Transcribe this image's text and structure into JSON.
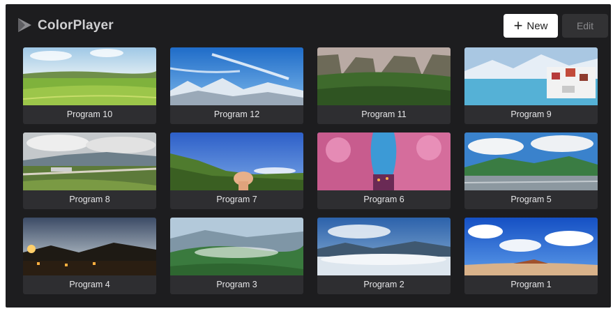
{
  "header": {
    "app_title": "ColorPlayer",
    "new_label": "New",
    "edit_label": "Edit"
  },
  "programs": [
    {
      "label": "Program 10",
      "scene": "green-field",
      "colors": {
        "sky": "#cfe3f2",
        "ground": "#7fb23c"
      }
    },
    {
      "label": "Program 12",
      "scene": "blue-sky-snow-mountains",
      "colors": {
        "sky": "#2f7fd4",
        "ground": "#e9eef5"
      }
    },
    {
      "label": "Program 11",
      "scene": "green-canyon-cliffs",
      "colors": {
        "sky": "#b7a7a2",
        "ground": "#3f6a2e"
      }
    },
    {
      "label": "Program 9",
      "scene": "snow-village-lake",
      "colors": {
        "sky": "#8fb6d9",
        "ground": "#5ab3d6"
      }
    },
    {
      "label": "Program 8",
      "scene": "cloudy-valley-town",
      "colors": {
        "sky": "#bfc3c6",
        "ground": "#5c7a3a"
      }
    },
    {
      "label": "Program 7",
      "scene": "mountain-hand-gesture",
      "colors": {
        "sky": "#3f6fd1",
        "ground": "#4d7a2e"
      }
    },
    {
      "label": "Program 6",
      "scene": "cherry-blossom-canal",
      "colors": {
        "sky": "#4aa0d8",
        "ground": "#d46c9a"
      }
    },
    {
      "label": "Program 5",
      "scene": "mountain-lake-clouds",
      "colors": {
        "sky": "#3e86cf",
        "ground": "#3a7c43"
      }
    },
    {
      "label": "Program 4",
      "scene": "night-city-lights",
      "colors": {
        "sky": "#5d6e86",
        "ground": "#2a1e12"
      }
    },
    {
      "label": "Program 3",
      "scene": "misty-green-mountains",
      "colors": {
        "sky": "#a9c3d8",
        "ground": "#3a7a3e"
      }
    },
    {
      "label": "Program 2",
      "scene": "sea-of-clouds",
      "colors": {
        "sky": "#3a72b8",
        "ground": "#d8e3ec"
      }
    },
    {
      "label": "Program 1",
      "scene": "blue-sky-beach",
      "colors": {
        "sky": "#1e5fd0",
        "ground": "#d9b28a"
      }
    }
  ]
}
